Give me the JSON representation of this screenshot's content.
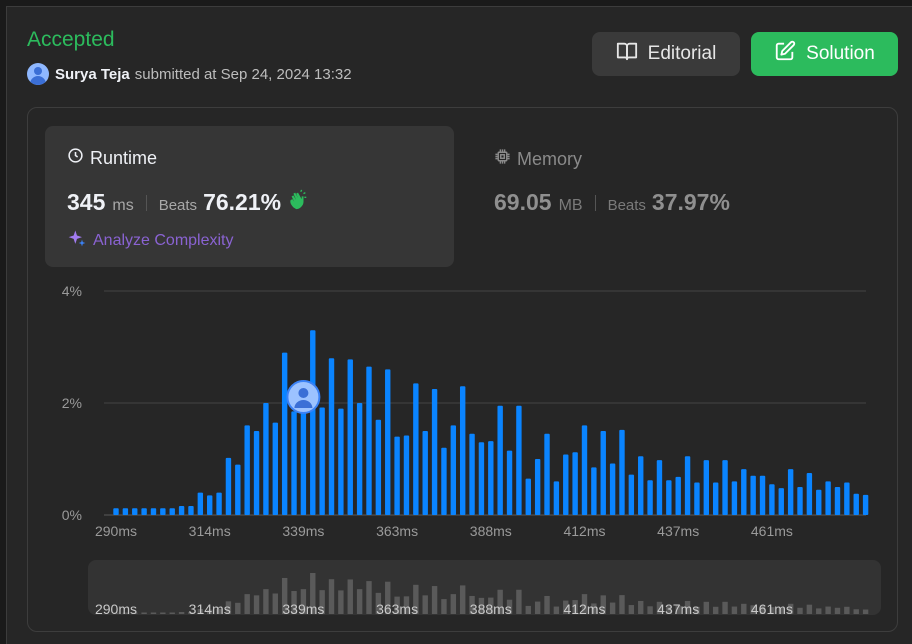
{
  "submission": {
    "status": "Accepted",
    "user_name": "Surya Teja",
    "submitted_text": "submitted at Sep 24, 2024 13:32"
  },
  "buttons": {
    "editorial": "Editorial",
    "solution": "Solution"
  },
  "runtime": {
    "title": "Runtime",
    "value": "345",
    "unit": "ms",
    "beats_label": "Beats",
    "beats_value": "76.21%",
    "analyze_label": "Analyze Complexity"
  },
  "memory": {
    "title": "Memory",
    "value": "69.05",
    "unit": "MB",
    "beats_label": "Beats",
    "beats_value": "37.97%"
  },
  "colors": {
    "accepted": "#2cbb5d",
    "bar": "#0a84ff",
    "mini_bar": "#5a5a5a",
    "analyze": "#8a63d2",
    "clap": "#2cbb5d"
  },
  "chart_data": {
    "type": "bar",
    "ylabel": "",
    "xlabel": "",
    "y_tick_labels": [
      "0%",
      "2%",
      "4%"
    ],
    "y_ticks": [
      0,
      2,
      4
    ],
    "ylim": [
      0,
      4
    ],
    "x_tick_labels": [
      "290ms",
      "314ms",
      "339ms",
      "363ms",
      "388ms",
      "412ms",
      "437ms",
      "461ms"
    ],
    "x_tick_bar_index": [
      0,
      10,
      20,
      30,
      40,
      50,
      60,
      70
    ],
    "user_bar_index": 20,
    "values": [
      0.12,
      0.12,
      0.12,
      0.12,
      0.12,
      0.12,
      0.12,
      0.16,
      0.16,
      0.4,
      0.35,
      0.4,
      1.02,
      0.9,
      1.6,
      1.5,
      2.0,
      1.65,
      2.9,
      1.85,
      2.0,
      3.3,
      1.92,
      2.8,
      1.9,
      2.78,
      2.0,
      2.65,
      1.7,
      2.6,
      1.4,
      1.42,
      2.35,
      1.5,
      2.25,
      1.2,
      1.6,
      2.3,
      1.45,
      1.3,
      1.32,
      1.95,
      1.15,
      1.95,
      0.65,
      1.0,
      1.45,
      0.6,
      1.08,
      1.12,
      1.6,
      0.85,
      1.5,
      0.92,
      1.52,
      0.72,
      1.05,
      0.62,
      0.98,
      0.62,
      0.68,
      1.05,
      0.58,
      0.98,
      0.58,
      0.98,
      0.6,
      0.82,
      0.7,
      0.7,
      0.55,
      0.48,
      0.82,
      0.5,
      0.75,
      0.45,
      0.6,
      0.5,
      0.58,
      0.38,
      0.36
    ]
  }
}
